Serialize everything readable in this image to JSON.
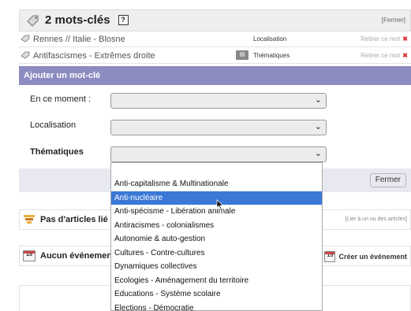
{
  "keywords_header": {
    "title": "2 mots-clés",
    "help": "?",
    "close_link": "[Fermer]"
  },
  "keyword_rows": [
    {
      "name": "Rennes // Italie - Blosne",
      "group": "Localisation",
      "remove": "Retirer ce mot",
      "x": "✖"
    },
    {
      "name": "Antifascismes - Extrêmes droite",
      "group": "Thématiques",
      "remove": "Retirer ce mot",
      "x": "✖"
    }
  ],
  "add_keyword": {
    "title": "Ajouter un mot-clé",
    "fields": [
      {
        "label": "En ce moment :"
      },
      {
        "label": "Localisation"
      },
      {
        "label": "Thématiques"
      }
    ],
    "close_button": "Fermer"
  },
  "articles": {
    "label": "Pas d'articles lié",
    "link": "[Lier à un ou des articles]"
  },
  "events": {
    "label": "Aucun événemen",
    "create": "Créer un événement"
  },
  "dropdown": {
    "options": [
      "Anti-capitalisme & Multinationale",
      "Anti-nucléaire",
      "Anti-spécisme - Libération animale",
      "Antiracismes - colonialismes",
      "Autonomie & auto-gestion",
      "Cultures - Contre-cultures",
      "Dynamiques collectives",
      "Ecologies - Aménagement du territoire",
      "Educations - Système scolaire",
      "Elections - Démocratie"
    ],
    "highlighted_index": 1
  },
  "colors": {
    "panel_header": "#8c8cc0",
    "highlight": "#3a78d8",
    "remove_x": "#dd3333"
  }
}
